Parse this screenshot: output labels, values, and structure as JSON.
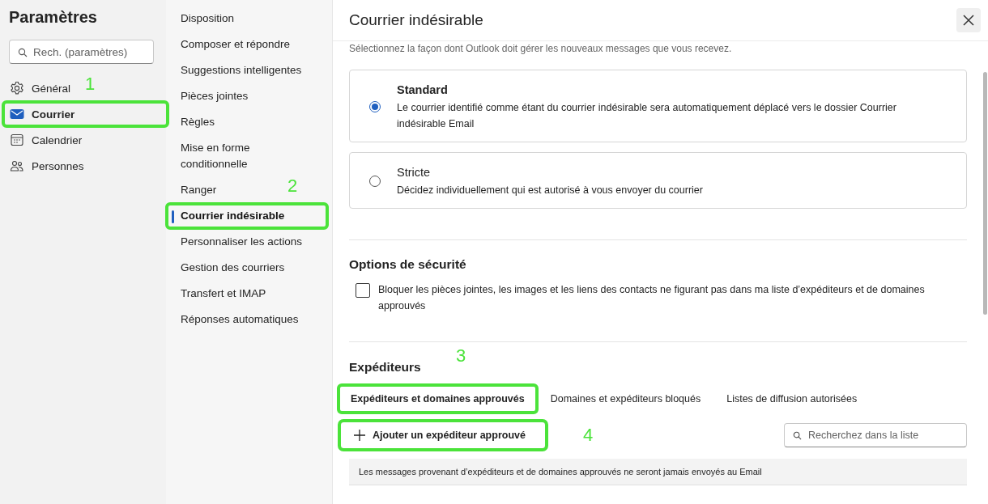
{
  "sidebar": {
    "title": "Paramètres",
    "search": {
      "placeholder": "Rech. (paramètres)"
    },
    "items": [
      {
        "label": "Général",
        "selected": false,
        "highlighted": false
      },
      {
        "label": "Courrier",
        "selected": true,
        "highlighted": true,
        "callout": "1"
      },
      {
        "label": "Calendrier",
        "selected": false,
        "highlighted": false
      },
      {
        "label": "Personnes",
        "selected": false,
        "highlighted": false
      }
    ]
  },
  "subnav": {
    "items": [
      {
        "label": "Disposition",
        "selected": false,
        "highlighted": false
      },
      {
        "label": "Composer et répondre",
        "selected": false,
        "highlighted": false
      },
      {
        "label": "Suggestions intelligentes",
        "selected": false,
        "highlighted": false
      },
      {
        "label": "Pièces jointes",
        "selected": false,
        "highlighted": false
      },
      {
        "label": "Règles",
        "selected": false,
        "highlighted": false
      },
      {
        "label": "Mise en forme conditionnelle",
        "selected": false,
        "highlighted": false
      },
      {
        "label": "Ranger",
        "selected": false,
        "highlighted": false
      },
      {
        "label": "Courrier indésirable",
        "selected": true,
        "highlighted": true,
        "callout": "2"
      },
      {
        "label": "Personnaliser les actions",
        "selected": false,
        "highlighted": false
      },
      {
        "label": "Gestion des courriers",
        "selected": false,
        "highlighted": false
      },
      {
        "label": "Transfert et IMAP",
        "selected": false,
        "highlighted": false
      },
      {
        "label": "Réponses automatiques",
        "selected": false,
        "highlighted": false
      }
    ]
  },
  "panel": {
    "title": "Courrier indésirable",
    "intro": "Sélectionnez la façon dont Outlook doit gérer les nouveaux messages que vous recevez.",
    "options": [
      {
        "title": "Standard",
        "description": "Le courrier identifié comme étant du courrier indésirable sera automatiquement déplacé vers le dossier Courrier indésirable Email",
        "selected": true
      },
      {
        "title": "Stricte",
        "description": "Décidez individuellement qui est autorisé à vous envoyer du courrier",
        "selected": false
      }
    ],
    "security": {
      "heading": "Options de sécurité",
      "checkbox": {
        "label": "Bloquer les pièces jointes, les images et les liens des contacts ne figurant pas dans ma liste d’expéditeurs et de domaines approuvés",
        "checked": false
      }
    },
    "senders": {
      "heading": "Expéditeurs",
      "tabs": [
        {
          "label": "Expéditeurs et domaines approuvés",
          "selected": true,
          "highlighted": true,
          "callout": "3"
        },
        {
          "label": "Domaines et expéditeurs bloqués",
          "selected": false,
          "highlighted": false
        },
        {
          "label": "Listes de diffusion autorisées",
          "selected": false,
          "highlighted": false
        }
      ],
      "add_button": {
        "label": "Ajouter un expéditeur approuvé",
        "highlighted": true,
        "callout": "4"
      },
      "search": {
        "placeholder": "Recherchez dans la liste"
      },
      "info": "Les messages provenant d’expéditeurs et de domaines approuvés ne seront jamais envoyés au Email"
    }
  }
}
